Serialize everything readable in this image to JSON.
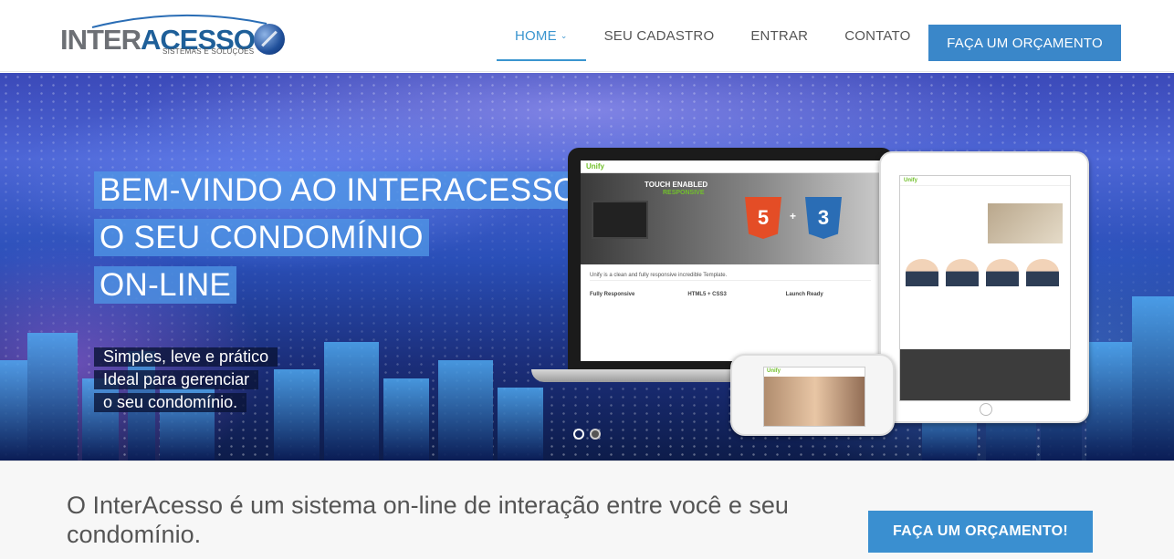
{
  "brand": {
    "name_part1": "INTER",
    "name_part2": "ACESSO",
    "tagline": "SISTEMAS E SOLUÇÕES",
    "accent_color": "#3a87c9"
  },
  "nav": {
    "items": [
      {
        "label": "HOME",
        "active": true,
        "has_dropdown": true
      },
      {
        "label": "SEU CADASTRO",
        "active": false
      },
      {
        "label": "ENTRAR",
        "active": false
      },
      {
        "label": "CONTATO",
        "active": false
      }
    ],
    "cta_label": "FAÇA UM ORÇAMENTO"
  },
  "hero": {
    "title_lines": [
      "BEM-VINDO AO INTERACESSO",
      "O SEU CONDOMÍNIO",
      "ON-LINE"
    ],
    "subtitle_lines": [
      "Simples, leve e prático",
      "Ideal para gerenciar",
      "o seu condomínio."
    ],
    "slider": {
      "count": 2,
      "active_index": 1
    },
    "devices": {
      "laptop_brand": "Unify",
      "laptop_banner_1": "TOUCH ENABLED",
      "laptop_banner_2": "RESPONSIVE",
      "laptop_strip": "Unify is a clean and fully responsive incredible Template.",
      "laptop_features": [
        "Fully Responsive",
        "HTML5 + CSS3",
        "Launch Ready"
      ],
      "tablet_brand": "Unify",
      "phone_brand": "Unify"
    }
  },
  "promo": {
    "text": "O InterAcesso é um sistema on-line de interação entre você e seu condomínio.",
    "button_label": "FAÇA UM ORÇAMENTO!"
  }
}
